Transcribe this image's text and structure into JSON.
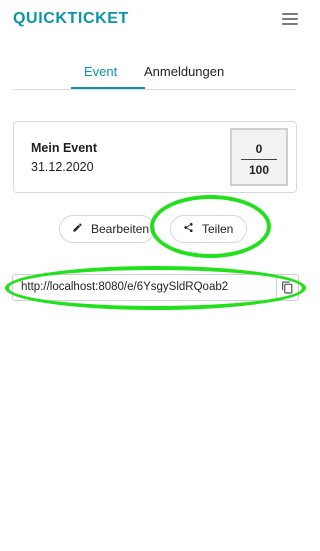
{
  "app": {
    "logo": "QUICKTICKET"
  },
  "tabs": [
    {
      "label": "Event",
      "active": true
    },
    {
      "label": "Anmeldungen",
      "active": false
    }
  ],
  "event": {
    "name": "Mein Event",
    "date": "31.12.2020",
    "registered": "0",
    "capacity": "100"
  },
  "actions": {
    "edit_label": "Bearbeiten",
    "share_label": "Teilen"
  },
  "share_link": {
    "value": "http://localhost:8080/e/6YsgySldRQoab2"
  },
  "icons": {
    "menu": "menu-icon",
    "edit": "pencil-icon",
    "share": "share-icon",
    "copy": "copy-icon"
  },
  "colors": {
    "accent": "#0a96a6",
    "highlight": "#22e01c"
  }
}
